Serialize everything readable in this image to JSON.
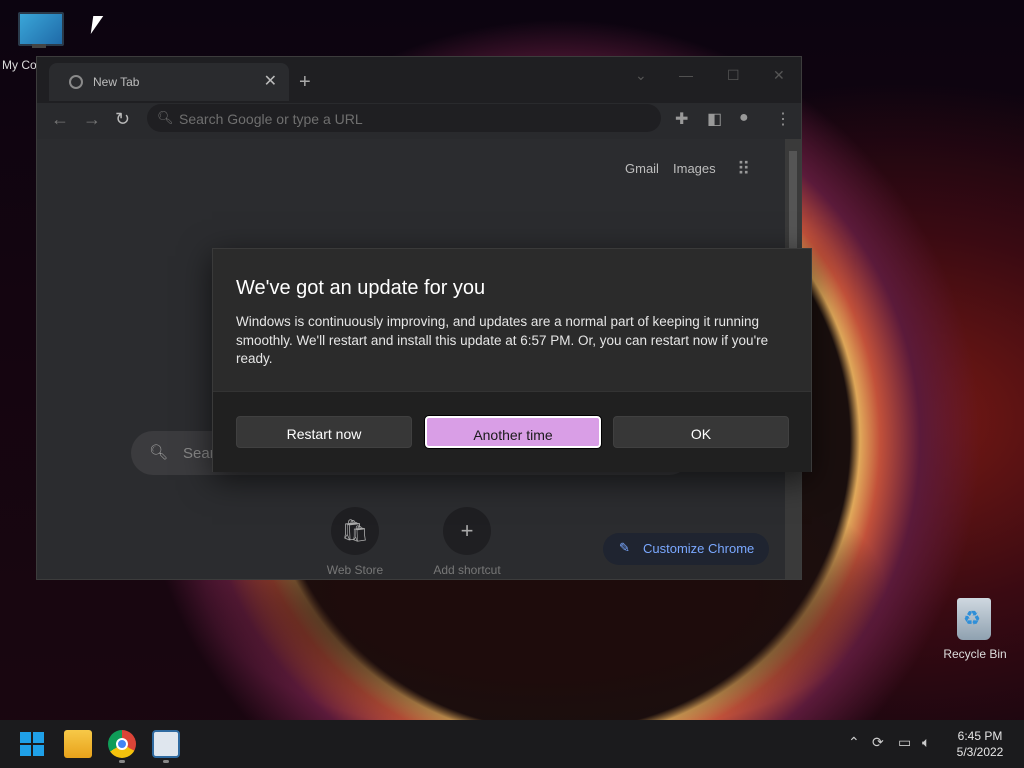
{
  "desktop": {
    "my_computer_label": "My Co",
    "recycle_bin_label": "Recycle Bin"
  },
  "chrome": {
    "tab_title": "New Tab",
    "tab_close": "✕",
    "new_tab": "+",
    "omnibox_placeholder": "Search Google or type a URL",
    "gmail": "Gmail",
    "images": "Images",
    "search_placeholder": "Sear",
    "shortcuts": [
      {
        "label": "Web Store"
      },
      {
        "label": "Add shortcut"
      }
    ],
    "customize_label": "Customize Chrome"
  },
  "dialog": {
    "title": "We've got an update for you",
    "body": "Windows is continuously improving, and updates are a normal part of keeping it running smoothly. We'll restart and install this update at 6:57 PM. Or, you can restart now if you're ready.",
    "buttons": {
      "restart": "Restart now",
      "another": "Another time",
      "ok": "OK"
    },
    "accent_color": "#d99ee6"
  },
  "taskbar": {
    "time": "6:45 PM",
    "date": "5/3/2022"
  }
}
